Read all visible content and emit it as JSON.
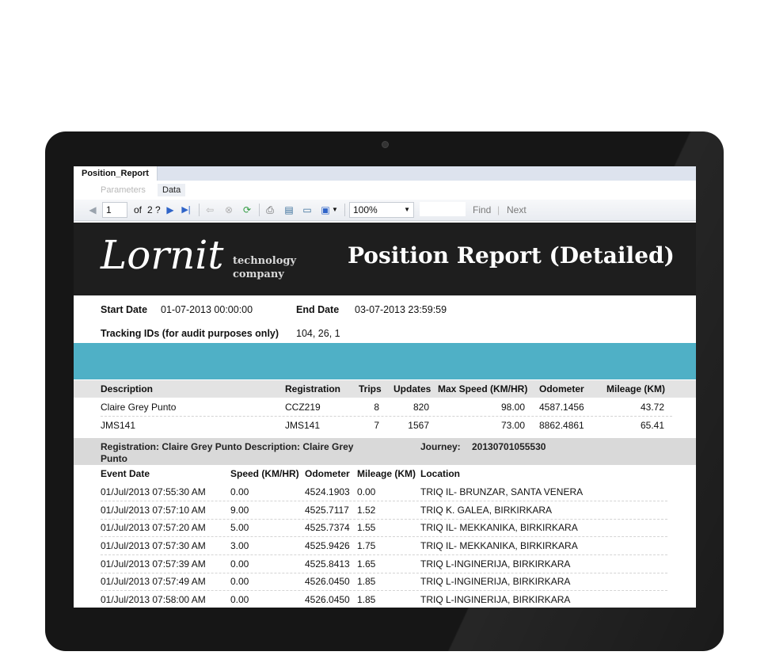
{
  "tab": {
    "title": "Position_Report"
  },
  "subtabs": {
    "parameters": "Parameters",
    "data": "Data"
  },
  "toolbar": {
    "page_current": "1",
    "page_of": "of",
    "page_total": "2 ?",
    "zoom": "100%",
    "find": "Find",
    "divider": "|",
    "next": "Next"
  },
  "brand": {
    "logo": "Lornit",
    "sub1": "technology",
    "sub2": "company"
  },
  "report": {
    "title": "Position Report (Detailed)",
    "start_label": "Start Date",
    "start_value": "01-07-2013 00:00:00",
    "end_label": "End Date",
    "end_value": "03-07-2013 23:59:59",
    "tracking_label": "Tracking IDs (for audit purposes only)",
    "tracking_value": "104, 26, 1"
  },
  "summary": {
    "headers": [
      "Description",
      "Registration",
      "Trips",
      "Updates",
      "Max Speed (KM/HR)",
      "Odometer",
      "Mileage (KM)"
    ],
    "rows": [
      [
        "Claire Grey Punto",
        "CCZ219",
        "8",
        "820",
        "98.00",
        "4587.1456",
        "43.72"
      ],
      [
        "JMS141",
        "JMS141",
        "7",
        "1567",
        "73.00",
        "8862.4861",
        "65.41"
      ]
    ]
  },
  "detail": {
    "header_line1": "Registration: Claire Grey Punto Description: Claire Grey",
    "header_line2": "Punto",
    "journey_label": "Journey:",
    "journey_value": "20130701055530",
    "headers": [
      "Event Date",
      "Speed (KM/HR)",
      "Odometer",
      "Mileage (KM)",
      "Location"
    ],
    "rows": [
      [
        "01/Jul/2013 07:55:30 AM",
        "0.00",
        "4524.1903",
        "0.00",
        "TRIQ IL- BRUNZAR, SANTA VENERA"
      ],
      [
        "01/Jul/2013 07:57:10 AM",
        "9.00",
        "4525.7117",
        "1.52",
        "TRIQ K. GALEA, BIRKIRKARA"
      ],
      [
        "01/Jul/2013 07:57:20 AM",
        "5.00",
        "4525.7374",
        "1.55",
        "TRIQ IL- MEKKANIKA, BIRKIRKARA"
      ],
      [
        "01/Jul/2013 07:57:30 AM",
        "3.00",
        "4525.9426",
        "1.75",
        "TRIQ IL- MEKKANIKA, BIRKIRKARA"
      ],
      [
        "01/Jul/2013 07:57:39 AM",
        "0.00",
        "4525.8413",
        "1.65",
        "TRIQ L-INGINERIJA, BIRKIRKARA"
      ],
      [
        "01/Jul/2013 07:57:49 AM",
        "0.00",
        "4526.0450",
        "1.85",
        "TRIQ L-INGINERIJA, BIRKIRKARA"
      ],
      [
        "01/Jul/2013 07:58:00 AM",
        "0.00",
        "4526.0450",
        "1.85",
        "TRIQ L-INGINERIJA, BIRKIRKARA"
      ]
    ]
  },
  "colors": {
    "accent_bar": "#4fb0c6",
    "header_bg": "#1e1e1e",
    "toolbar_icon": "#2f64c8"
  },
  "icons": [
    "first-page-icon",
    "prev-page-icon",
    "next-page-icon",
    "last-page-icon",
    "back-icon",
    "stop-icon",
    "refresh-icon",
    "print-icon",
    "print-layout-icon",
    "page-setup-icon",
    "export-icon"
  ]
}
